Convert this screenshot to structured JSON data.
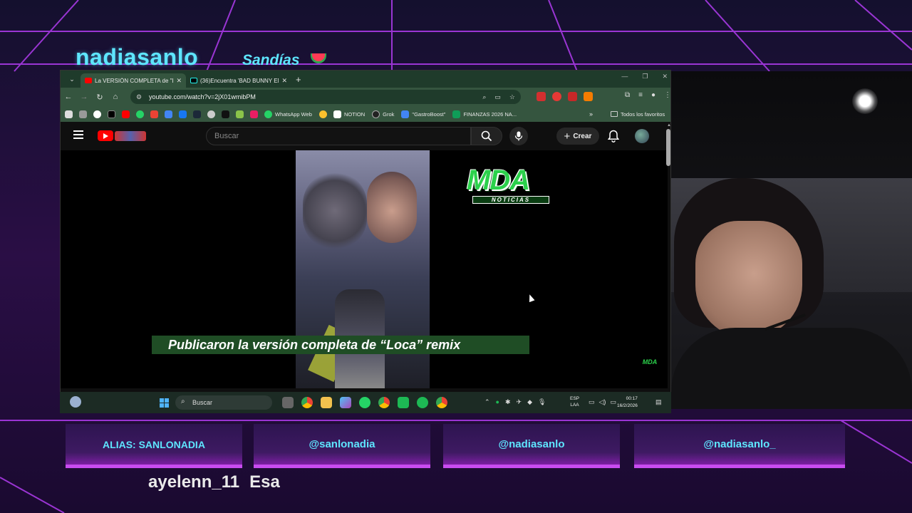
{
  "overlay": {
    "channel_name": "nadiasanlo",
    "subtitle": "Sandías",
    "links": [
      "ALIAS: SANLONADIA",
      "@sanlonadia",
      "@nadiasanlo",
      "@nadiasanlo_"
    ],
    "chat": {
      "user": "ayelenn_11",
      "message": "Esa"
    }
  },
  "browser": {
    "tabs": [
      {
        "title": "La VERSIÓN COMPLETA de \"LO",
        "active": true
      },
      {
        "title": "(36)Encuentra 'BAD BUNNY EN",
        "active": false
      }
    ],
    "url": "youtube.com/watch?v=2jX01wmibPM",
    "bookmarks": [
      "WhatsApp Web",
      "NOTION",
      "Grok",
      "\"GastroBoost\"",
      "FINANZAS 2026 NA..."
    ],
    "all_bookmarks": "Todos los favoritos"
  },
  "youtube": {
    "search_placeholder": "Buscar",
    "create_label": "Crear",
    "video": {
      "logo_main": "MDA",
      "logo_sub": "NOTICIAS",
      "caption": "Publicaron la versión completa de “Loca” remix",
      "watermark": "MDA"
    }
  },
  "taskbar": {
    "search_placeholder": "Buscar",
    "lang_line1": "ESP",
    "lang_line2": "LAA",
    "time": "00:17",
    "date": "16/2/2026"
  },
  "colors": {
    "accent_cyan": "#5ee6ff",
    "neon_purple": "#c84cf0",
    "browser_green": "#35553f",
    "mda_green": "#2bd14b"
  }
}
